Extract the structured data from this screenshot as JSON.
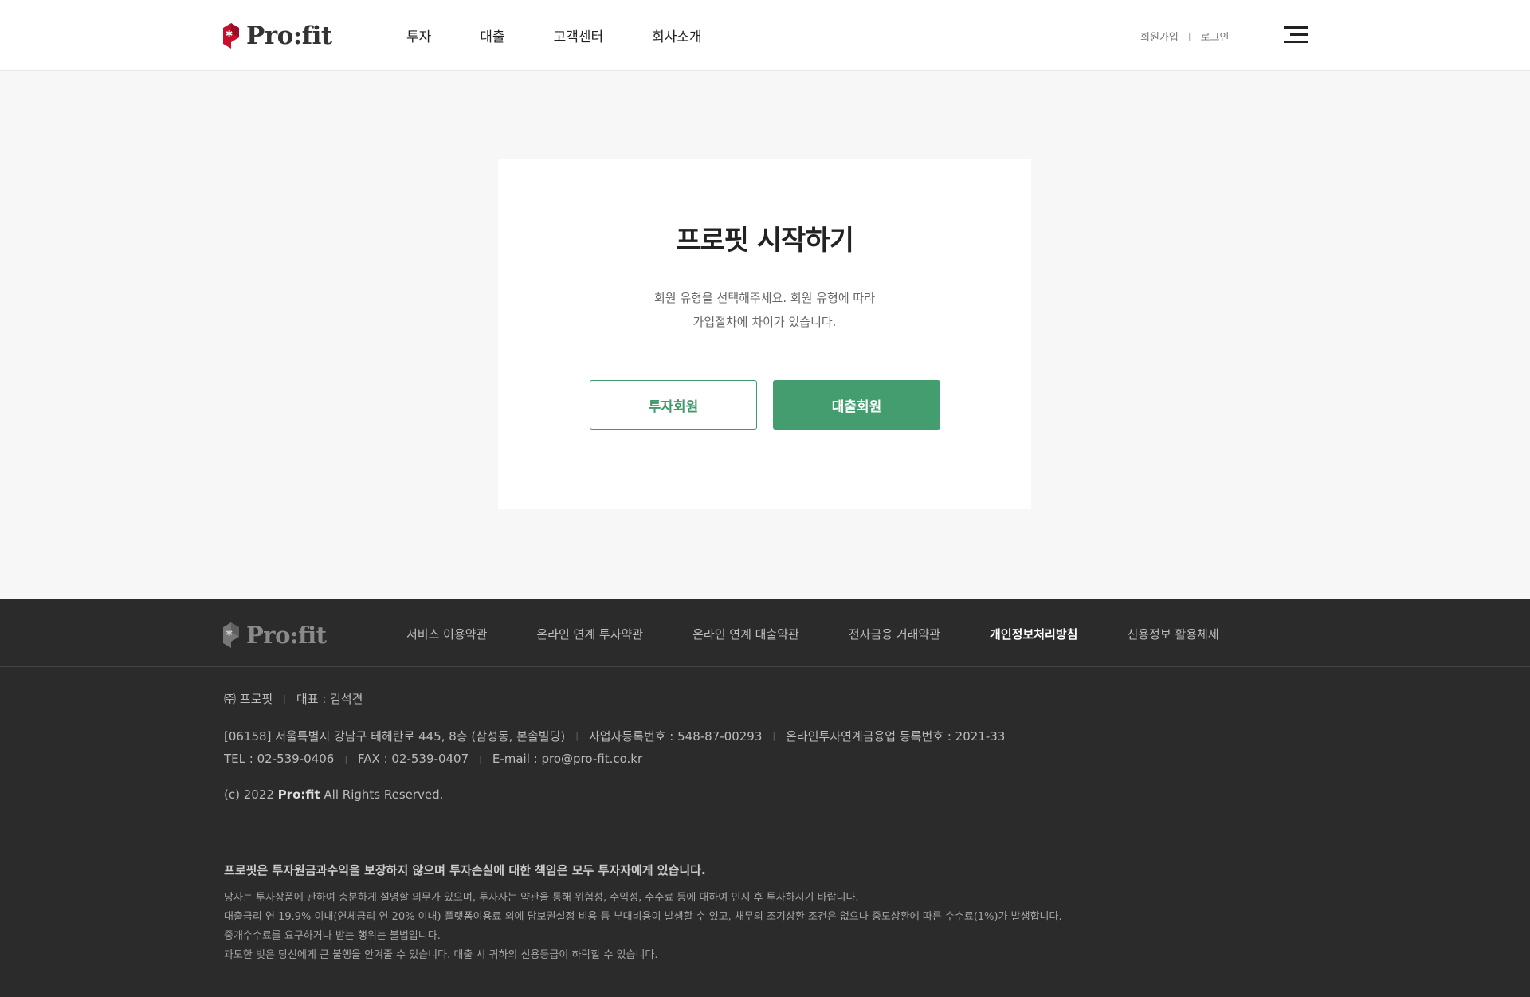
{
  "header": {
    "logo_text": "Pro:fit",
    "nav": [
      "투자",
      "대출",
      "고객센터",
      "회사소개"
    ],
    "signup_label": "회원가입",
    "util_separator": "|",
    "login_label": "로그인",
    "menu_icon": "hamburger-menu-icon"
  },
  "main": {
    "title": "프로핏 시작하기",
    "description_line1": "회원 유형을 선택해주세요. 회원 유형에 따라",
    "description_line2": "가입절차에 차이가 있습니다.",
    "invest_member_button": "투자회원",
    "loan_member_button": "대출회원"
  },
  "footer": {
    "logo_text": "Pro:fit",
    "links": [
      {
        "label": "서비스 이용약관",
        "bold": false
      },
      {
        "label": "온라인 연계 투자약관",
        "bold": false
      },
      {
        "label": "온라인 연계 대출약관",
        "bold": false
      },
      {
        "label": "전자금융 거래약관",
        "bold": false
      },
      {
        "label": "개인정보처리방침",
        "bold": true
      },
      {
        "label": "신용정보 활용체제",
        "bold": false
      }
    ],
    "company": "㈜ 프로핏",
    "ceo": "대표 : 김석견",
    "address": "[06158] 서울특별시 강남구 테헤란로 445, 8층 (삼성동, 본솔빌딩)",
    "business_reg": "사업자등록번호 : 548-87-00293",
    "p2p_reg": "온라인투자연계금융업 등록번호 : 2021-33",
    "tel": "TEL : 02-539-0406",
    "fax": "FAX : 02-539-0407",
    "email": "E-mail : pro@pro-fit.co.kr",
    "copyright_prefix": "(c) 2022 ",
    "copyright_brand": "Pro:fit",
    "copyright_suffix": " All Rights Reserved.",
    "separator": "|",
    "warning": "프로핏은 투자원금과수익을 보장하지 않으며 투자손실에 대한 책임은 모두 투자자에게 있습니다.",
    "notes": [
      "당사는 투자상품에 관하여 충분하게 설명할 의무가 있으며, 투자자는 약관을 통해 위험성, 수익성, 수수료 등에 대하여 인지 후 투자하시기 바랍니다.",
      "대출금리 연 19.9% 이내(연체금리 연 20% 이내) 플랫폼이용료 외에 담보권설정 비용 등 부대비용이 발생할 수 있고, 채무의 조기상환 조건은 없으나 중도상환에 따른 수수료(1%)가 발생합니다.",
      "중개수수료를 요구하거나 받는 행위는 불법입니다.",
      "과도한 빚은 당신에게 큰 불행을 안겨줄 수 있습니다. 대출 시 귀하의 신용등급이 하락할 수 있습니다."
    ]
  },
  "colors": {
    "accent_green": "#449d6f",
    "logo_red": "#c8102e",
    "footer_bg": "#2b2b2b"
  }
}
